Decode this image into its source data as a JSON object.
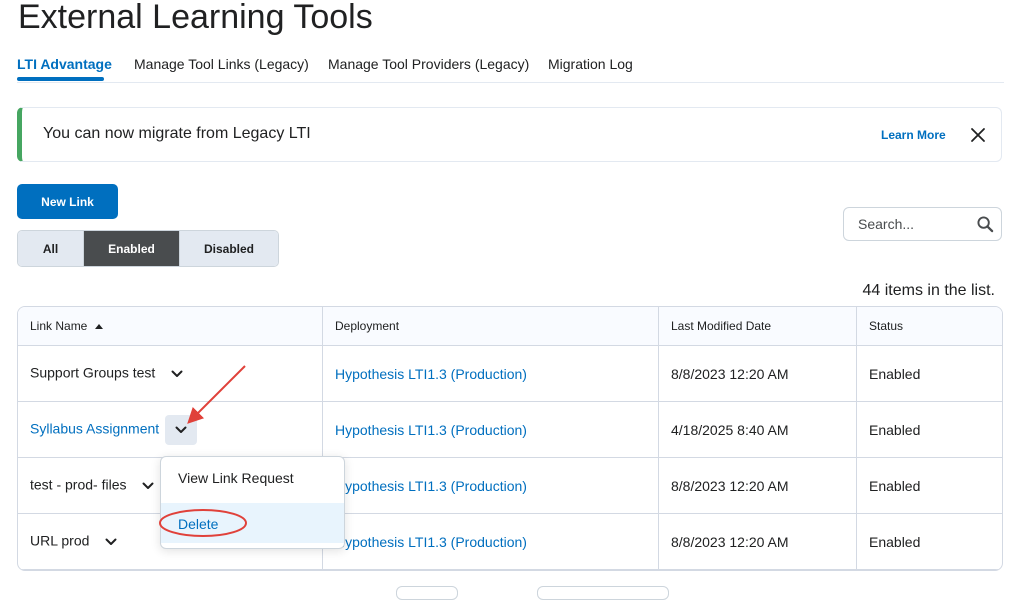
{
  "page": {
    "title": "External Learning Tools"
  },
  "tabs": [
    {
      "label": "LTI Advantage",
      "active": true
    },
    {
      "label": "Manage Tool Links (Legacy)",
      "active": false
    },
    {
      "label": "Manage Tool Providers (Legacy)",
      "active": false
    },
    {
      "label": "Migration Log",
      "active": false
    }
  ],
  "alert": {
    "message": "You can now migrate from Legacy LTI",
    "link": "Learn More",
    "accent": "#46a661"
  },
  "toolbar": {
    "new_link_label": "New Link",
    "filters": [
      {
        "label": "All",
        "active": false
      },
      {
        "label": "Enabled",
        "active": true
      },
      {
        "label": "Disabled",
        "active": false
      }
    ],
    "search_placeholder": "Search..."
  },
  "list": {
    "count_text": "44 items in the list."
  },
  "table": {
    "headers": [
      "Link Name",
      "Deployment",
      "Last Modified Date",
      "Status"
    ],
    "rows": [
      {
        "name": "Support Groups test",
        "deployment": "Hypothesis LTI1.3 (Production)",
        "modified": "8/8/2023 12:20 AM",
        "status": "Enabled"
      },
      {
        "name": "Syllabus Assignment",
        "deployment": "Hypothesis LTI1.3 (Production)",
        "modified": "4/18/2025 8:40 AM",
        "status": "Enabled"
      },
      {
        "name": "test - prod- files",
        "deployment": "Hypothesis LTI1.3 (Production)",
        "modified": "8/8/2023 12:20 AM",
        "status": "Enabled"
      },
      {
        "name": "URL prod",
        "deployment": "Hypothesis LTI1.3 (Production)",
        "modified": "8/8/2023 12:20 AM",
        "status": "Enabled"
      }
    ]
  },
  "context_menu": {
    "items": [
      "View Link Request",
      "Delete"
    ]
  },
  "colors": {
    "primary": "#006fbf",
    "annotation": "#e0413a"
  }
}
